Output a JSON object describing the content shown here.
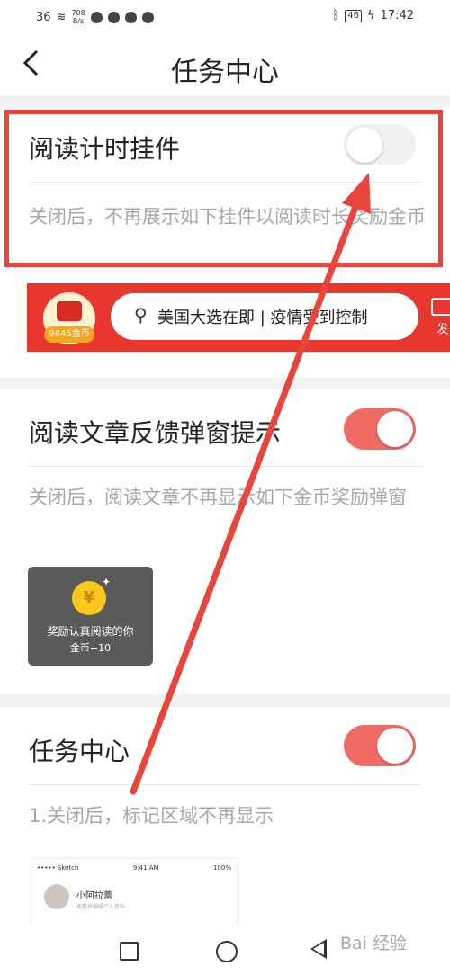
{
  "status_bar": {
    "signal": "36",
    "net_speed": "708",
    "net_unit": "B/s",
    "battery": "46",
    "time": "17:42"
  },
  "header": {
    "back_icon": "chevron-left-icon",
    "title": "任务中心"
  },
  "sections": [
    {
      "title": "阅读计时挂件",
      "toggle": "off",
      "description": "关闭后，不再展示如下挂件以阅读时长奖励金币"
    },
    {
      "title": "阅读文章反馈弹窗提示",
      "toggle": "on",
      "description": "关闭后，阅读文章不再显示如下金币奖励弹窗"
    },
    {
      "title": "任务中心",
      "toggle": "on",
      "description": "1.关闭后，标记区域不再显示"
    }
  ],
  "widget_preview": {
    "coin_count": "9845金币",
    "search_text": "美国大选在即 | 疫情受到控制",
    "publish_label": "发"
  },
  "reward_popup": {
    "coin_symbol": "¥",
    "line1": "奖励认真阅读的你",
    "line2": "金币+10"
  },
  "task_preview": {
    "carrier": "••••• Sketch",
    "time": "9:41 AM",
    "battery": "100%",
    "name": "小阿拉蕾",
    "sub": "查看并编辑个人资料"
  },
  "watermark": "Bai 经验",
  "colors": {
    "accent": "#ef6b63",
    "highlight": "#e8453c",
    "banner": "#e8372f"
  }
}
